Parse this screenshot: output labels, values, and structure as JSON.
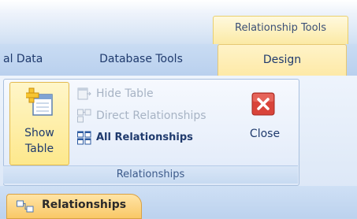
{
  "contextual": {
    "title": "Relationship Tools"
  },
  "tabs": [
    {
      "label": "al Data"
    },
    {
      "label": "Database Tools"
    },
    {
      "label": "Design"
    }
  ],
  "group": {
    "caption": "Relationships",
    "show_table": {
      "line1": "Show",
      "line2": "Table"
    },
    "hide_table": "Hide Table",
    "direct_relationships": "Direct Relationships",
    "all_relationships": "All Relationships",
    "close": "Close"
  },
  "document_tab": {
    "label": "Relationships"
  },
  "colors": {
    "close_red": "#d9443a",
    "active_tab": "#fde9a6",
    "ribbon_blue": "#bfd4ee"
  }
}
